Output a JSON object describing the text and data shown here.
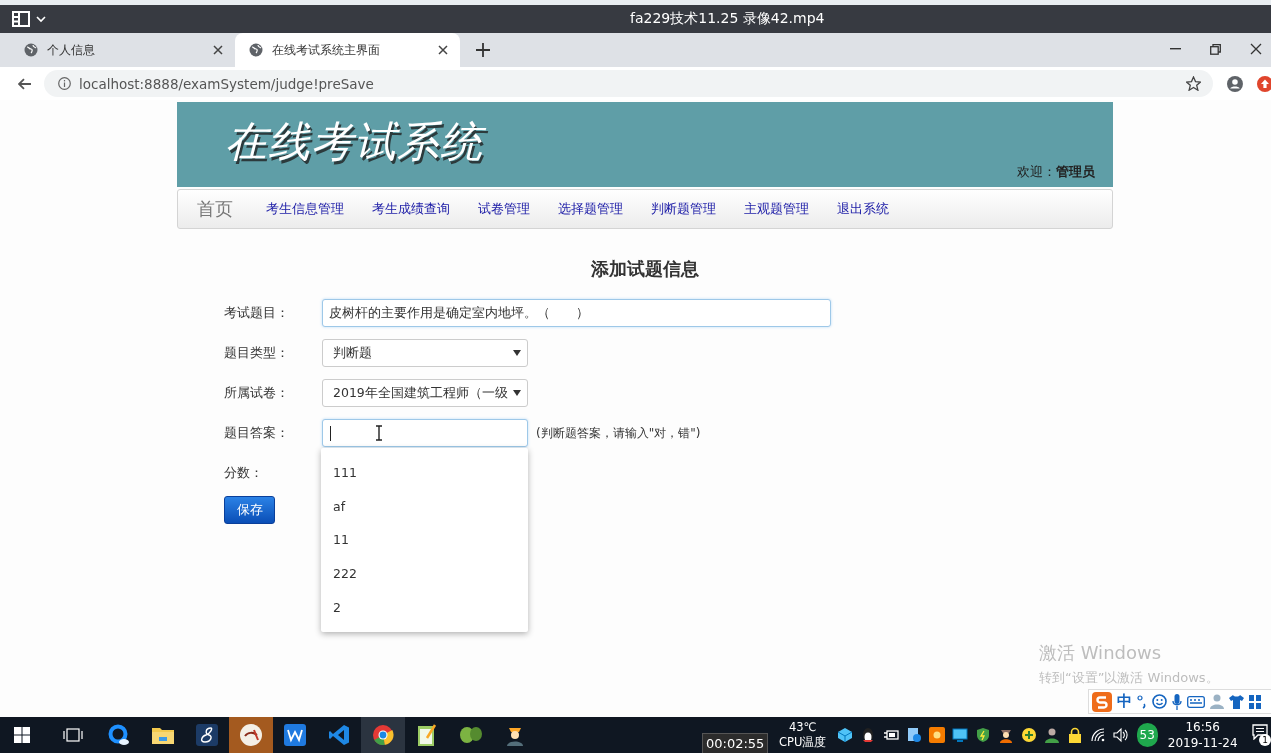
{
  "player": {
    "title": "fa229技术11.25 录像42.mp4"
  },
  "browser": {
    "tabs": [
      {
        "label": "个人信息",
        "selected": false
      },
      {
        "label": "在线考试系统主界面",
        "selected": true
      }
    ],
    "address": "localhost:8888/examSystem/judge!preSave"
  },
  "page": {
    "site_title": "在线考试系统",
    "welcome": "欢迎：**管理员**",
    "nav": [
      {
        "label": "首页",
        "kind": "home"
      },
      {
        "label": "考生信息管理",
        "kind": "link"
      },
      {
        "label": "考生成绩查询",
        "kind": "link"
      },
      {
        "label": "试卷管理",
        "kind": "link"
      },
      {
        "label": "选择题管理",
        "kind": "link"
      },
      {
        "label": "判断题管理",
        "kind": "link"
      },
      {
        "label": "主观题管理",
        "kind": "link"
      },
      {
        "label": "退出系统",
        "kind": "link"
      }
    ],
    "form_title": "添加试题信息",
    "fields": [
      {
        "label": "考试题目：",
        "kind": "text",
        "value": "皮树杆的主要作用是确定室内地坪。（　　）"
      },
      {
        "label": "题目类型：",
        "kind": "select",
        "value": "判断题"
      },
      {
        "label": "所属试卷：",
        "kind": "select",
        "value": "2019年全国建筑工程师（一级"
      },
      {
        "label": "题目答案：",
        "kind": "focused_text",
        "hint": "(判断题答案，请输入\"对，错\")"
      },
      {
        "label": "分数：",
        "kind": "label_only"
      }
    ],
    "suggestions": [
      "111",
      "af",
      "11",
      "222",
      "2"
    ],
    "save_button": "保存"
  },
  "activation": {
    "heading": "激活 Windows",
    "message": "转到“设置”以激活 Windows。"
  },
  "ime": {
    "mode": "中"
  },
  "taskbar": {
    "tooltip": "00:02:55",
    "temperature": "43℃",
    "temperature_label": "CPU温度",
    "badge": "53",
    "time": "16:56",
    "date": "2019-11-24",
    "notifications": "1"
  }
}
